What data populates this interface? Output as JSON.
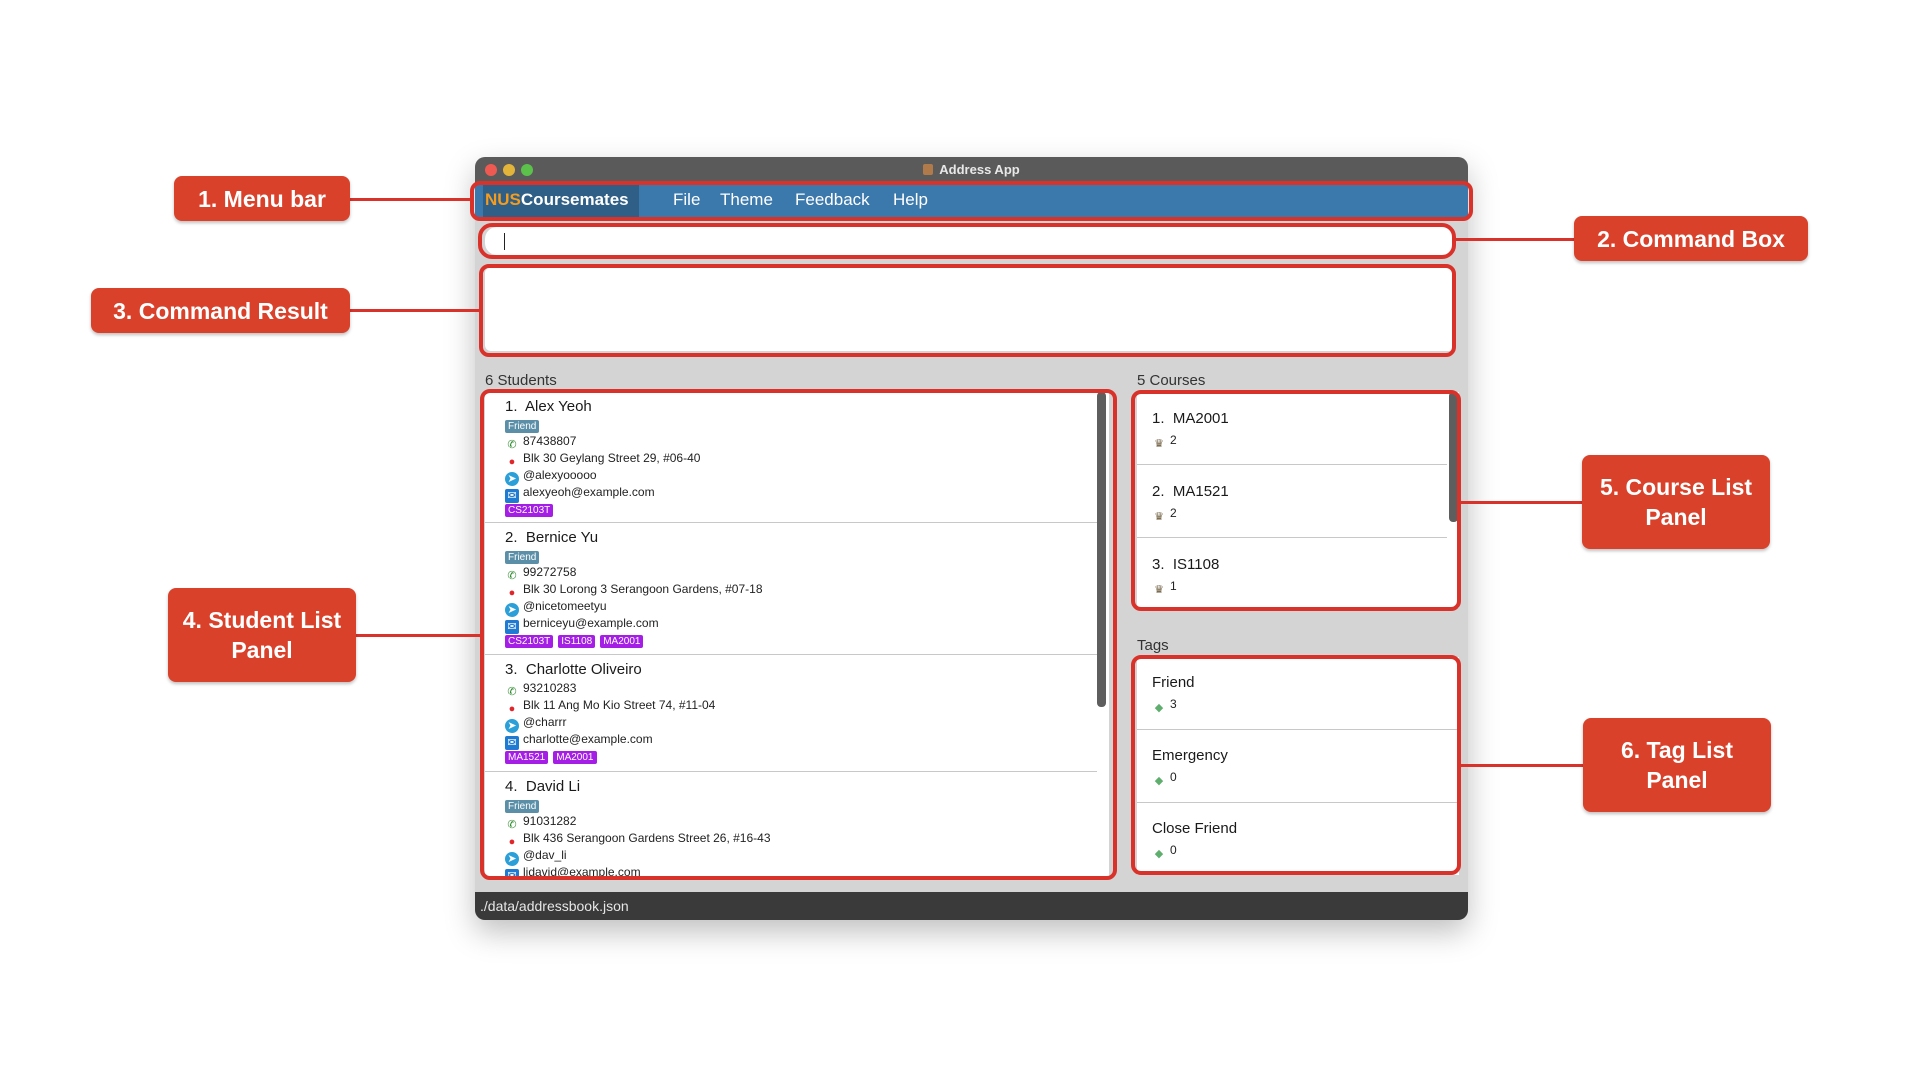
{
  "window": {
    "title": "Address App"
  },
  "menu": {
    "brand_part1": "NUS",
    "brand_part2": "Coursemates",
    "items": [
      "File",
      "Theme",
      "Feedback",
      "Help"
    ]
  },
  "command_box": {
    "value": ""
  },
  "students": {
    "header": "6 Students",
    "list": [
      {
        "index": "1.",
        "name": "Alex Yeoh",
        "tags": [
          "Friend"
        ],
        "phone": "87438807",
        "address": "Blk 30 Geylang Street 29, #06-40",
        "telegram": "@alexyooooo",
        "email": "alexyeoh@example.com",
        "courses": [
          "CS2103T"
        ]
      },
      {
        "index": "2.",
        "name": "Bernice Yu",
        "tags": [
          "Friend"
        ],
        "phone": "99272758",
        "address": "Blk 30 Lorong 3 Serangoon Gardens, #07-18",
        "telegram": "@nicetomeetyu",
        "email": "berniceyu@example.com",
        "courses": [
          "CS2103T",
          "IS1108",
          "MA2001"
        ]
      },
      {
        "index": "3.",
        "name": "Charlotte Oliveiro",
        "tags": [],
        "phone": "93210283",
        "address": "Blk 11 Ang Mo Kio Street 74, #11-04",
        "telegram": "@charrr",
        "email": "charlotte@example.com",
        "courses": [
          "MA1521",
          "MA2001"
        ]
      },
      {
        "index": "4.",
        "name": "David Li",
        "tags": [
          "Friend"
        ],
        "phone": "91031282",
        "address": "Blk 436 Serangoon Gardens Street 26, #16-43",
        "telegram": "@dav_li",
        "email": "lidavid@example.com",
        "courses": []
      }
    ]
  },
  "courses": {
    "header": "5 Courses",
    "list": [
      {
        "index": "1.",
        "code": "MA2001",
        "count": "2"
      },
      {
        "index": "2.",
        "code": "MA1521",
        "count": "2"
      },
      {
        "index": "3.",
        "code": "IS1108",
        "count": "1"
      }
    ]
  },
  "tags": {
    "header": "Tags",
    "list": [
      {
        "name": "Friend",
        "count": "3"
      },
      {
        "name": "Emergency",
        "count": "0"
      },
      {
        "name": "Close Friend",
        "count": "0"
      }
    ]
  },
  "status_bar": {
    "path": "./data/addressbook.json"
  },
  "callouts": {
    "menu_bar": "1. Menu bar",
    "command_box": "2. Command Box",
    "command_result": "3. Command Result",
    "student_list": "4. Student List Panel",
    "course_list": "5. Course List Panel",
    "tag_list": "6. Tag List Panel"
  },
  "colors": {
    "accent_red": "#d9322a",
    "menubar": "#3b78ab",
    "course_tag": "#a41ee6",
    "friend_tag": "#5b8fa8",
    "brand_orange": "#f39c1f"
  }
}
